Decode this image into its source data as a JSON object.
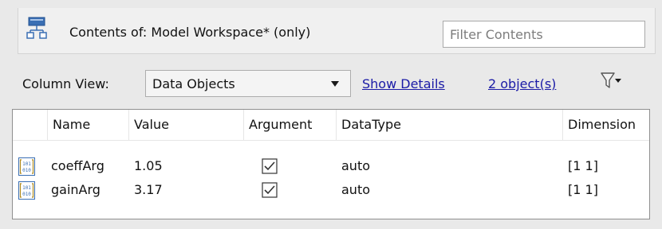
{
  "header": {
    "contents_label": "Contents of:  Model Workspace*  (only)",
    "filter_placeholder": "Filter Contents"
  },
  "toolbar": {
    "column_view_label": "Column View:",
    "column_view_value": "Data Objects",
    "show_details": "Show Details",
    "object_count": "2 object(s)"
  },
  "table": {
    "columns": [
      "Name",
      "Value",
      "Argument",
      "DataType",
      "Dimension"
    ],
    "rows": [
      {
        "name": "coeffArg",
        "value": "1.05",
        "argument": true,
        "datatype": "auto",
        "dimension": "[1 1]"
      },
      {
        "name": "gainArg",
        "value": "3.17",
        "argument": true,
        "datatype": "auto",
        "dimension": "[1 1]"
      }
    ]
  },
  "icons": {
    "workspace": "model-workspace-icon",
    "variable": "variable-icon",
    "filter": "filter-funnel-icon",
    "checkbox": "checkbox-checked-icon"
  },
  "colors": {
    "link": "#1a1aa6",
    "icon_blue": "#3a6fb4",
    "variable_icon": "#b08a1e",
    "background": "#e9e9e9"
  }
}
